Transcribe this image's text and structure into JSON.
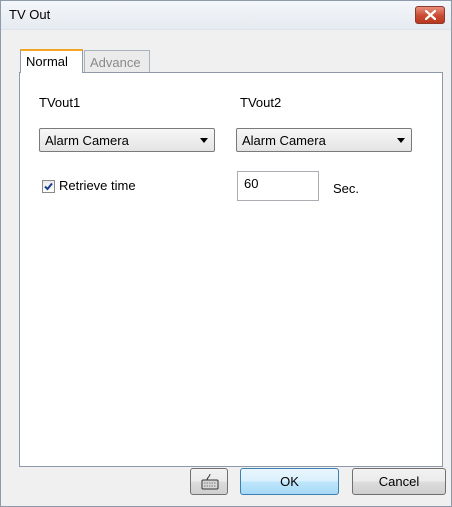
{
  "window": {
    "title": "TV Out"
  },
  "tabs": [
    {
      "label": "Normal",
      "active": true
    },
    {
      "label": "Advance",
      "active": false
    }
  ],
  "normal": {
    "tvout1_label": "TVout1",
    "tvout2_label": "TVout2",
    "tvout1_value": "Alarm Camera",
    "tvout2_value": "Alarm Camera",
    "retrieve_label": "Retrieve time",
    "retrieve_checked": true,
    "retrieve_value": "60",
    "retrieve_unit": "Sec."
  },
  "buttons": {
    "keyboard_icon": "keyboard-icon",
    "ok": "OK",
    "cancel": "Cancel"
  },
  "colors": {
    "active_tab_accent": "#f5a623",
    "close_button": "#c94a32"
  }
}
